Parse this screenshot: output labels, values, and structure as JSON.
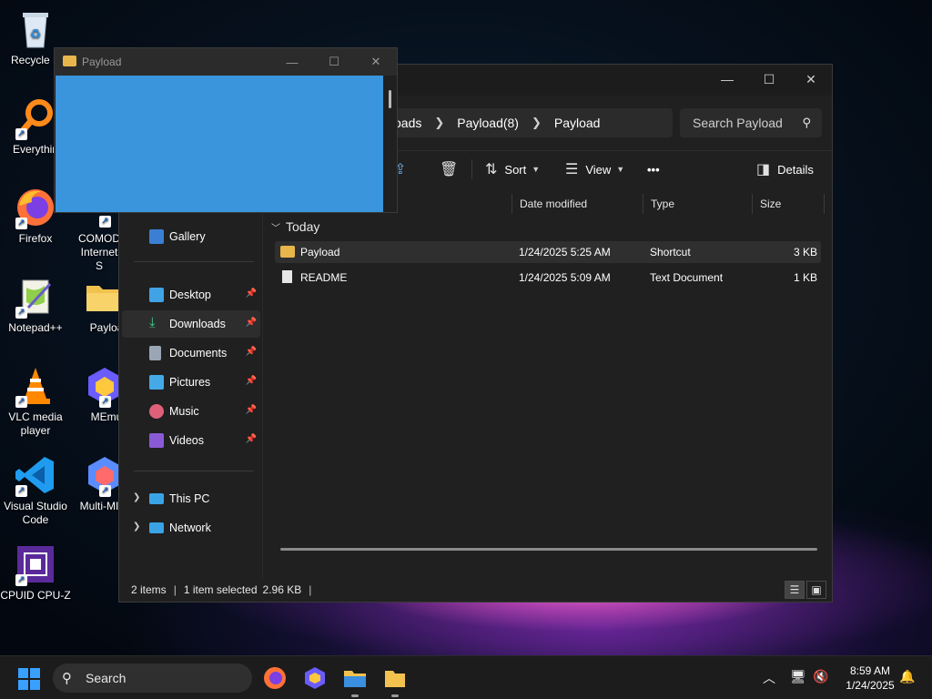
{
  "desktop": {
    "icons": [
      {
        "label": "Recycle B"
      },
      {
        "label": "Everythin"
      },
      {
        "label": "Firefox"
      },
      {
        "label": "COMOD Internet S"
      },
      {
        "label": "Notepad++"
      },
      {
        "label": "Payloa"
      },
      {
        "label": "VLC media player"
      },
      {
        "label": "MEmu"
      },
      {
        "label": "Visual Studio Code"
      },
      {
        "label": "Multi-MI"
      },
      {
        "label": "CPUID CPU-Z"
      }
    ]
  },
  "popup": {
    "title": "Payload",
    "color": "#3a95dc"
  },
  "explorer": {
    "breadcrumb": [
      "oads",
      "Payload(8)",
      "Payload"
    ],
    "search_placeholder": "Search Payload",
    "toolbar": {
      "sort": "Sort",
      "view": "View",
      "more": "•••",
      "details": "Details"
    },
    "sidebar": {
      "gallery": "Gallery",
      "quick": [
        {
          "label": "Desktop"
        },
        {
          "label": "Downloads"
        },
        {
          "label": "Documents"
        },
        {
          "label": "Pictures"
        },
        {
          "label": "Music"
        },
        {
          "label": "Videos"
        }
      ],
      "this_pc": "This PC",
      "network": "Network"
    },
    "columns": {
      "date": "Date modified",
      "type": "Type",
      "size": "Size"
    },
    "group": "Today",
    "files": [
      {
        "name": "Payload",
        "date": "1/24/2025 5:25 AM",
        "type": "Shortcut",
        "size": "3 KB"
      },
      {
        "name": "README",
        "date": "1/24/2025 5:09 AM",
        "type": "Text Document",
        "size": "1 KB"
      }
    ],
    "status": {
      "items": "2 items",
      "selected": "1 item selected",
      "size": "2.96 KB"
    }
  },
  "taskbar": {
    "search": "Search",
    "time": "8:59 AM",
    "date": "1/24/2025"
  }
}
